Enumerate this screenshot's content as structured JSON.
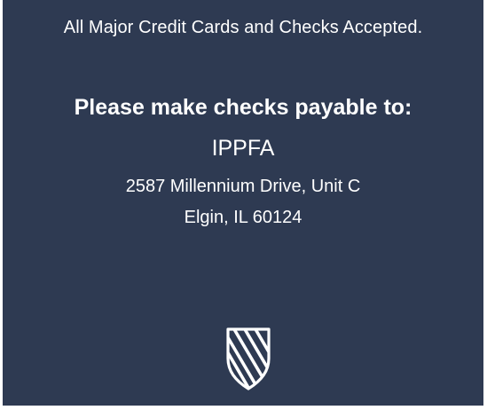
{
  "panel": {
    "background_color": "#2e3a52",
    "accepted_text": "All Major Credit Cards and Checks Accepted.",
    "heading": "Please make checks payable to:",
    "payee": "IPPFA",
    "address_line1": "2587 Millennium Drive, Unit C",
    "address_line2": "Elgin, IL 60124",
    "logo_icon": "shield-logo-icon"
  }
}
